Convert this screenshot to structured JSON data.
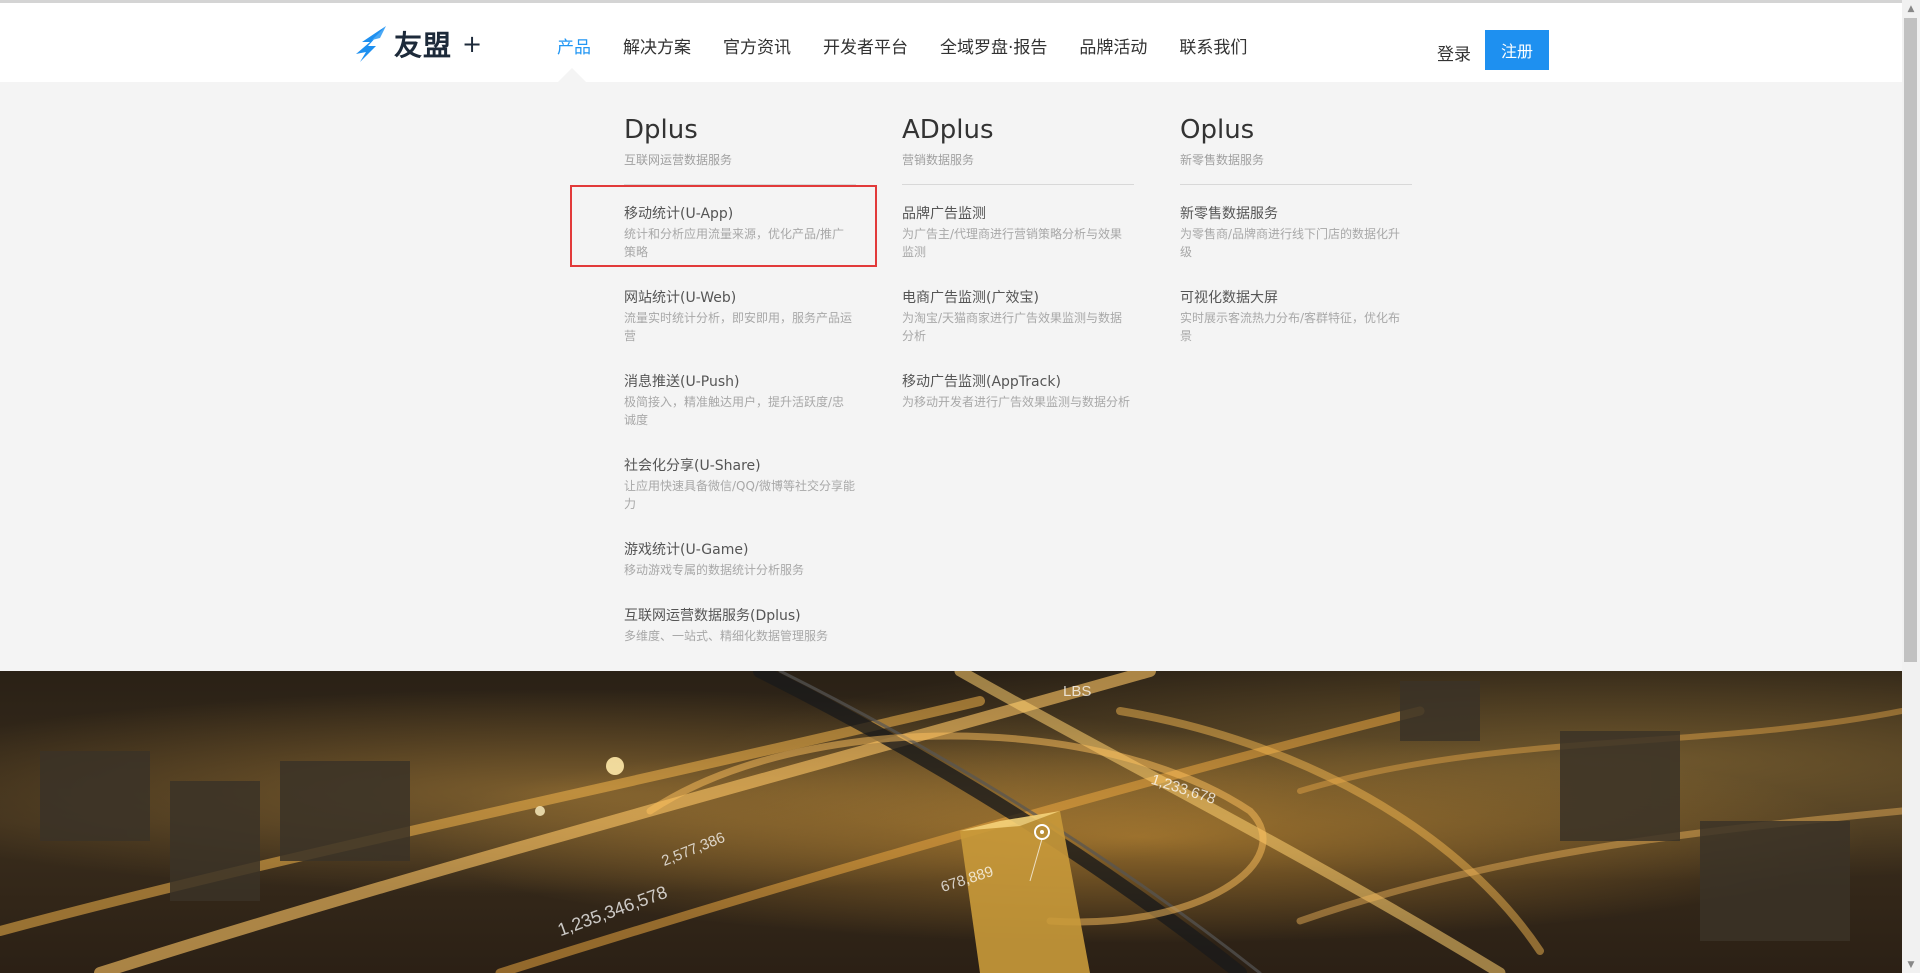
{
  "header": {
    "logo_text": "友盟",
    "logo_plus": "+",
    "nav": [
      "产品",
      "解决方案",
      "官方资讯",
      "开发者平台",
      "全域罗盘·报告",
      "品牌活动",
      "联系我们"
    ],
    "active_nav": "产品",
    "login_label": "登录",
    "register_label": "注册",
    "accent_color": "#1e90f0"
  },
  "dropdown": {
    "columns": [
      {
        "title": "Dplus",
        "subtitle": "互联网运营数据服务",
        "items": [
          {
            "title": "移动统计(U-App)",
            "desc": "统计和分析应用流量来源，优化产品/推广策略"
          },
          {
            "title": "网站统计(U-Web)",
            "desc": "流量实时统计分析，即安即用，服务产品运营"
          },
          {
            "title": "消息推送(U-Push)",
            "desc": "极简接入，精准触达用户，提升活跃度/忠诚度"
          },
          {
            "title": "社会化分享(U-Share)",
            "desc": "让应用快速具备微信/QQ/微博等社交分享能力"
          },
          {
            "title": "游戏统计(U-Game)",
            "desc": "移动游戏专属的数据统计分析服务"
          },
          {
            "title": "互联网运营数据服务(Dplus)",
            "desc": "多维度、一站式、精细化数据管理服务"
          }
        ]
      },
      {
        "title": "ADplus",
        "subtitle": "营销数据服务",
        "items": [
          {
            "title": "品牌广告监测",
            "desc": "为广告主/代理商进行营销策略分析与效果监测"
          },
          {
            "title": "电商广告监测(广效宝)",
            "desc": "为淘宝/天猫商家进行广告效果监测与数据分析"
          },
          {
            "title": "移动广告监测(AppTrack)",
            "desc": "为移动开发者进行广告效果监测与数据分析"
          }
        ]
      },
      {
        "title": "Oplus",
        "subtitle": "新零售数据服务",
        "items": [
          {
            "title": "新零售数据服务",
            "desc": "为零售商/品牌商进行线下门店的数据化升级"
          },
          {
            "title": "可视化数据大屏",
            "desc": "实时展示客流热力分布/客群特征，优化布景"
          }
        ]
      }
    ]
  },
  "hero": {
    "labels": [
      "LBS",
      "1,233,678",
      "2,577,386",
      "1,235,346,578",
      "678,889"
    ],
    "highlight_color": "#e23a3a"
  }
}
